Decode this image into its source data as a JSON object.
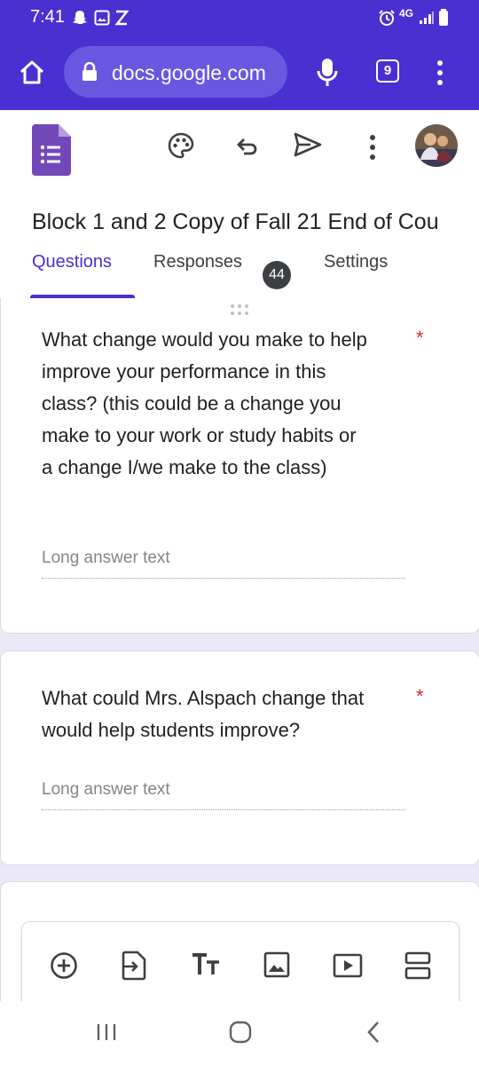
{
  "status_bar": {
    "time": "7:41",
    "left_icons": [
      "snapchat-icon",
      "gallery-icon",
      "z-icon"
    ],
    "right_icons": [
      "alarm-icon",
      "4g-icon",
      "signal-icon",
      "battery-icon"
    ],
    "network": "4G"
  },
  "browser": {
    "url": "docs.google.com",
    "tab_count": "9",
    "icons": [
      "home-icon",
      "lock-icon",
      "mic-icon",
      "more-vert-icon"
    ]
  },
  "app": {
    "icons": [
      "forms-logo-icon",
      "palette-icon",
      "undo-icon",
      "send-icon",
      "more-vert-icon",
      "avatar"
    ],
    "form_title": "Block 1 and 2 Copy of Fall 21 End of Cou",
    "tabs": [
      {
        "label": "Questions",
        "active": true
      },
      {
        "label": "Responses",
        "active": false,
        "badge": "44"
      },
      {
        "label": "Settings",
        "active": false
      }
    ]
  },
  "questions": [
    {
      "line1": "What change would you make to help",
      "line2": "improve your performance in this",
      "line3": "class? (this could be a change you",
      "line4": "make to your work or study habits or",
      "line5": "a change I/we make to the class)",
      "required_marker": "*",
      "answer_placeholder": "Long answer text"
    },
    {
      "line1": "What could Mrs. Alspach change that",
      "line2": "would help students improve?",
      "required_marker": "*",
      "answer_placeholder": "Long answer text"
    }
  ],
  "toolbar": {
    "icons": [
      "add-question-icon",
      "import-questions-icon",
      "add-title-icon",
      "add-image-icon",
      "add-video-icon",
      "add-section-icon"
    ]
  },
  "nav": {
    "icons": [
      "recents-icon",
      "home-icon",
      "back-icon"
    ]
  },
  "colors": {
    "accent": "#4a2fd1",
    "background": "#ece8f7",
    "required": "#d93025"
  }
}
